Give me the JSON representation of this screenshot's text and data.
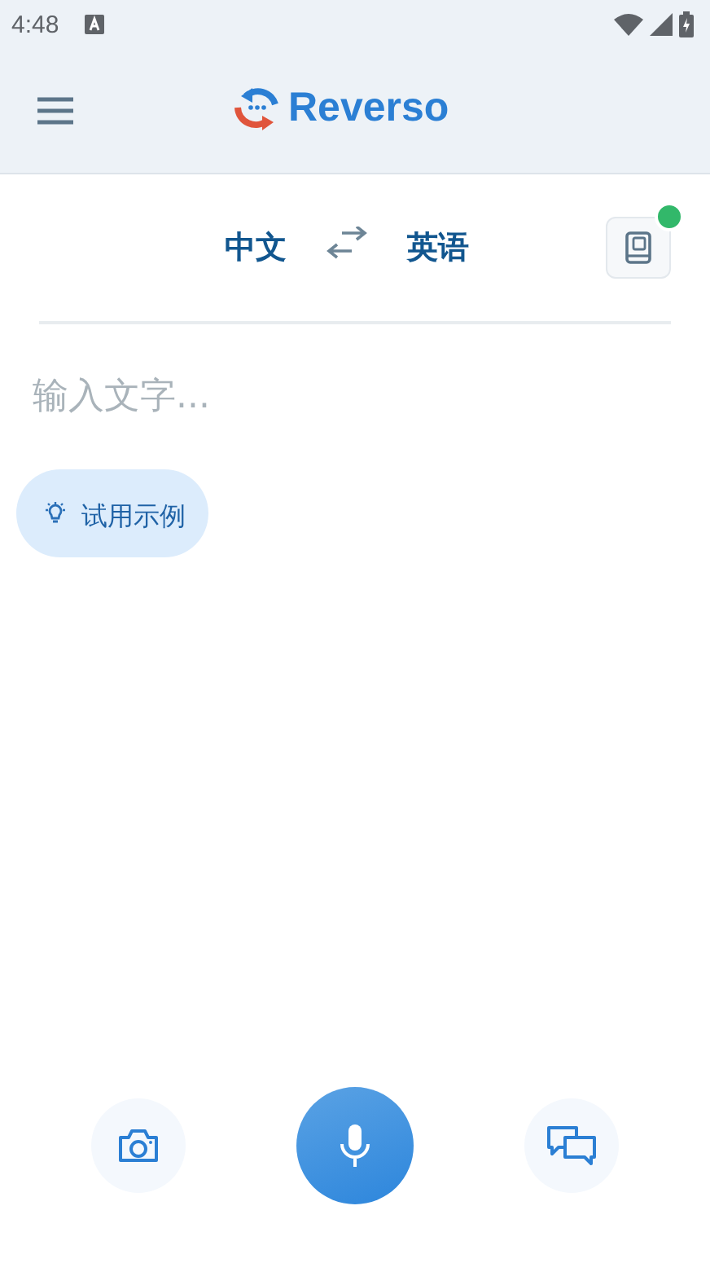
{
  "status_bar": {
    "time": "4:48"
  },
  "header": {
    "app_name": "Reverso"
  },
  "languages": {
    "source": "中文",
    "target": "英语",
    "dictionary_notification": true
  },
  "input": {
    "placeholder": "输入文字..."
  },
  "example_chip": {
    "label": "试用示例"
  }
}
